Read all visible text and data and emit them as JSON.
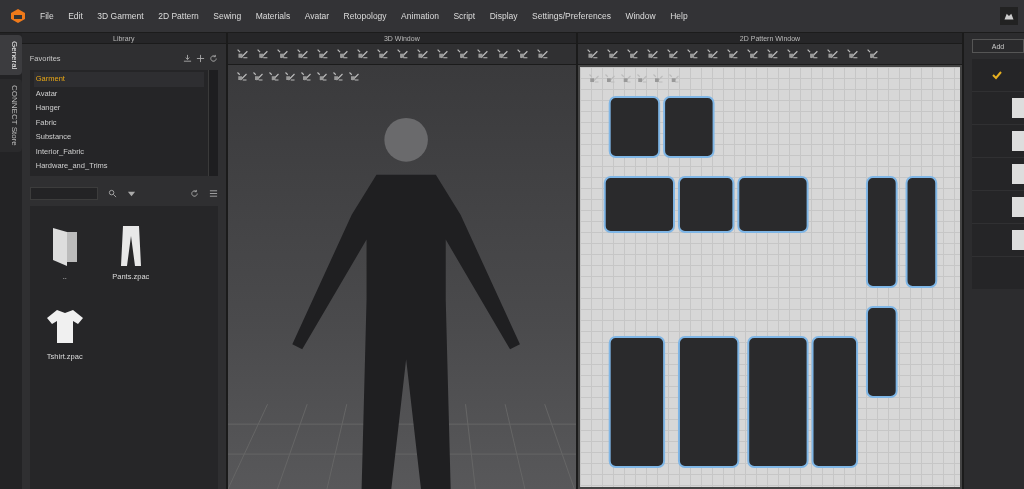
{
  "menu_bar": {
    "items": [
      "File",
      "Edit",
      "3D Garment",
      "2D Pattern",
      "Sewing",
      "Materials",
      "Avatar",
      "Retopology",
      "Animation",
      "Script",
      "Display",
      "Settings/Preferences",
      "Window",
      "Help"
    ]
  },
  "side_tabs": [
    {
      "label": "General",
      "selected": true
    },
    {
      "label": "CONNECT Store",
      "selected": false
    }
  ],
  "library": {
    "title": "Library",
    "favorites_title": "Favorites",
    "favorites": [
      {
        "label": "Garment",
        "selected": true
      },
      {
        "label": "Avatar",
        "selected": false
      },
      {
        "label": "Hanger",
        "selected": false
      },
      {
        "label": "Fabric",
        "selected": false
      },
      {
        "label": "Substance",
        "selected": false
      },
      {
        "label": "Interior_Fabric",
        "selected": false
      },
      {
        "label": "Hardware_and_Trims",
        "selected": false
      }
    ],
    "files": [
      {
        "name": "..",
        "kind": "folder"
      },
      {
        "name": "Pants.zpac",
        "kind": "pants"
      },
      {
        "name": "Tshirt.zpac",
        "kind": "tshirt"
      }
    ]
  },
  "window_3d": {
    "title": "3D Window"
  },
  "window_2d": {
    "title": "2D Pattern Window"
  },
  "right_panel": {
    "button": "Add",
    "rows": [
      {
        "checked": true
      },
      {
        "checked": false
      },
      {
        "checked": false
      },
      {
        "checked": false
      },
      {
        "checked": false
      },
      {
        "checked": false
      }
    ]
  }
}
